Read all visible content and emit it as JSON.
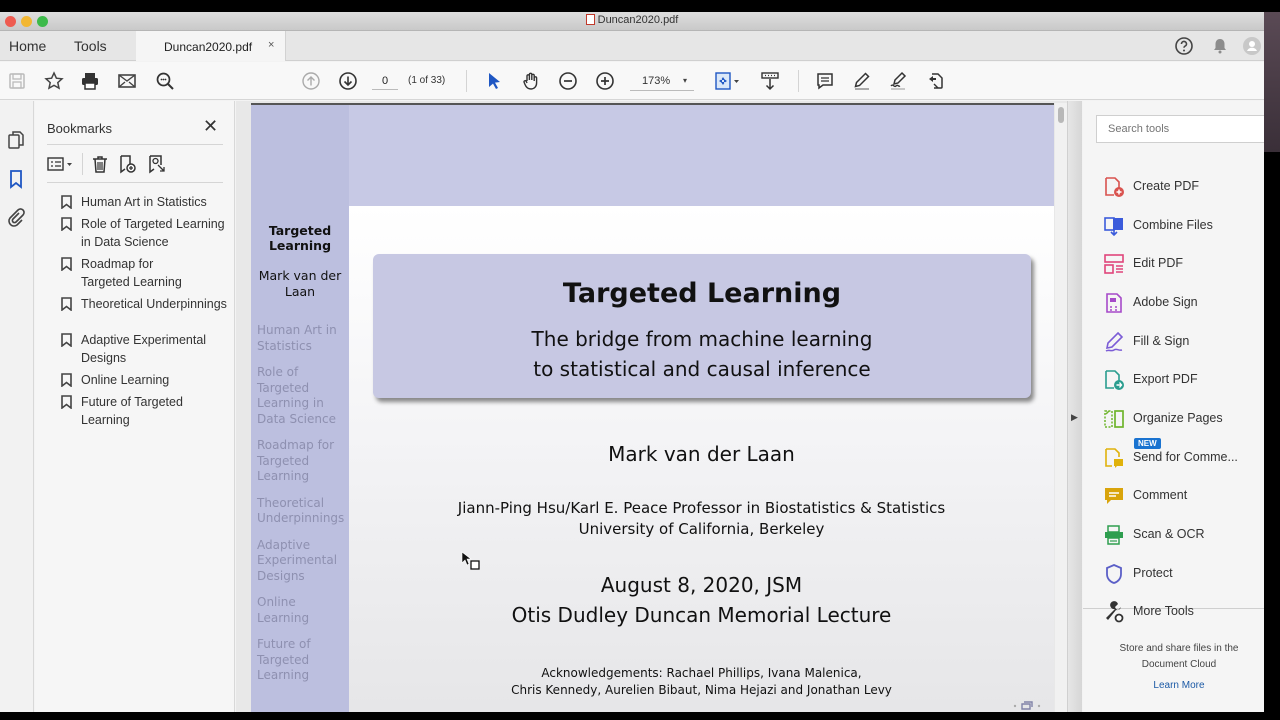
{
  "window": {
    "title": "Duncan2020.pdf"
  },
  "menubar": {
    "home_label": "Home",
    "tools_label": "Tools",
    "tab_label": "Duncan2020.pdf",
    "tab_close": "×"
  },
  "toolbar": {
    "page_value": "0",
    "page_count": "(1 of 33)",
    "zoom_value": "173%",
    "zoom_caret": "▾",
    "icons": [
      "save-icon",
      "bookmark-star-icon",
      "print-icon",
      "email-icon",
      "search-text-icon",
      "previous-page-icon",
      "next-page-icon",
      "select-arrow-icon",
      "hand-tool-icon",
      "zoom-out-icon",
      "zoom-in-icon",
      "fit-page-icon",
      "scroll-mode-icon",
      "comment-icon",
      "highlight-icon",
      "sign-icon",
      "share-icon"
    ]
  },
  "header_icons": [
    "help-icon",
    "notifications-bell-icon",
    "user-avatar-icon"
  ],
  "bookmarks": {
    "title": "Bookmarks",
    "close": "✕",
    "items": [
      {
        "label": "Human Art in Statistics"
      },
      {
        "label": "Role of Targeted Learning in Data Science"
      },
      {
        "label": "Roadmap for Targeted Learning"
      },
      {
        "label": "Theoretical Underpinnings"
      },
      {
        "label": "Adaptive Experimental Designs"
      },
      {
        "label": "Online Learning"
      },
      {
        "label": "Future of Targeted Learning"
      }
    ]
  },
  "slide": {
    "sidebar_title": "Targeted Learning",
    "sidebar_author": "Mark van der Laan",
    "sidebar_sections": [
      "Human Art in Statistics",
      "Role of Targeted Learning in Data Science",
      "Roadmap for Targeted Learning",
      "Theoretical Underpinnings",
      "Adaptive Experimental Designs",
      "Online Learning",
      "Future of Targeted Learning"
    ],
    "title": "Targeted Learning",
    "subtitle_line1": "The bridge from machine learning",
    "subtitle_line2": "to statistical and causal inference",
    "author": "Mark van der Laan",
    "affiliation_line1": "Jiann-Ping Hsu/Karl E. Peace Professor in Biostatistics & Statistics",
    "affiliation_line2": "University of California, Berkeley",
    "date_line": "August 8, 2020, JSM",
    "event_line": "Otis Dudley Duncan Memorial Lecture",
    "ack_line1": "Acknowledgements: Rachael Phillips, Ivana Malenica,",
    "ack_line2": "Chris Kennedy, Aurelien Bibaut, Nima Hejazi and Jonathan Levy",
    "colors": {
      "sidebar": "#bcbfdf",
      "header": "#c7c9e5",
      "title_box": "#c7c8e3",
      "section_text": "#8e90b0"
    }
  },
  "tools_panel": {
    "search_placeholder": "Search tools",
    "items": [
      {
        "label": "Create PDF",
        "icon": "create-pdf-icon",
        "color": "#d9534f"
      },
      {
        "label": "Combine Files",
        "icon": "combine-files-icon",
        "color": "#3b5bdb"
      },
      {
        "label": "Edit PDF",
        "icon": "edit-pdf-icon",
        "color": "#e0457b"
      },
      {
        "label": "Adobe Sign",
        "icon": "adobe-sign-icon",
        "color": "#a64ac9"
      },
      {
        "label": "Fill & Sign",
        "icon": "fill-sign-icon",
        "color": "#7b5cd6"
      },
      {
        "label": "Export PDF",
        "icon": "export-pdf-icon",
        "color": "#2a9d8f"
      },
      {
        "label": "Organize Pages",
        "icon": "organize-pages-icon",
        "color": "#6fb52c"
      },
      {
        "label": "Send for Comme...",
        "icon": "send-for-comment-icon",
        "color": "#e0b20b"
      },
      {
        "label": "Comment",
        "icon": "comment-tool-icon",
        "color": "#d9a40b"
      },
      {
        "label": "Scan & OCR",
        "icon": "scan-ocr-icon",
        "color": "#2e9e4f"
      },
      {
        "label": "Protect",
        "icon": "protect-shield-icon",
        "color": "#5b5fc7"
      },
      {
        "label": "More Tools",
        "icon": "more-tools-icon",
        "color": "#333333"
      }
    ],
    "new_badge": "NEW",
    "cloud_line1": "Store and share files in the",
    "cloud_line2": "Document Cloud",
    "learn_more": "Learn More"
  }
}
